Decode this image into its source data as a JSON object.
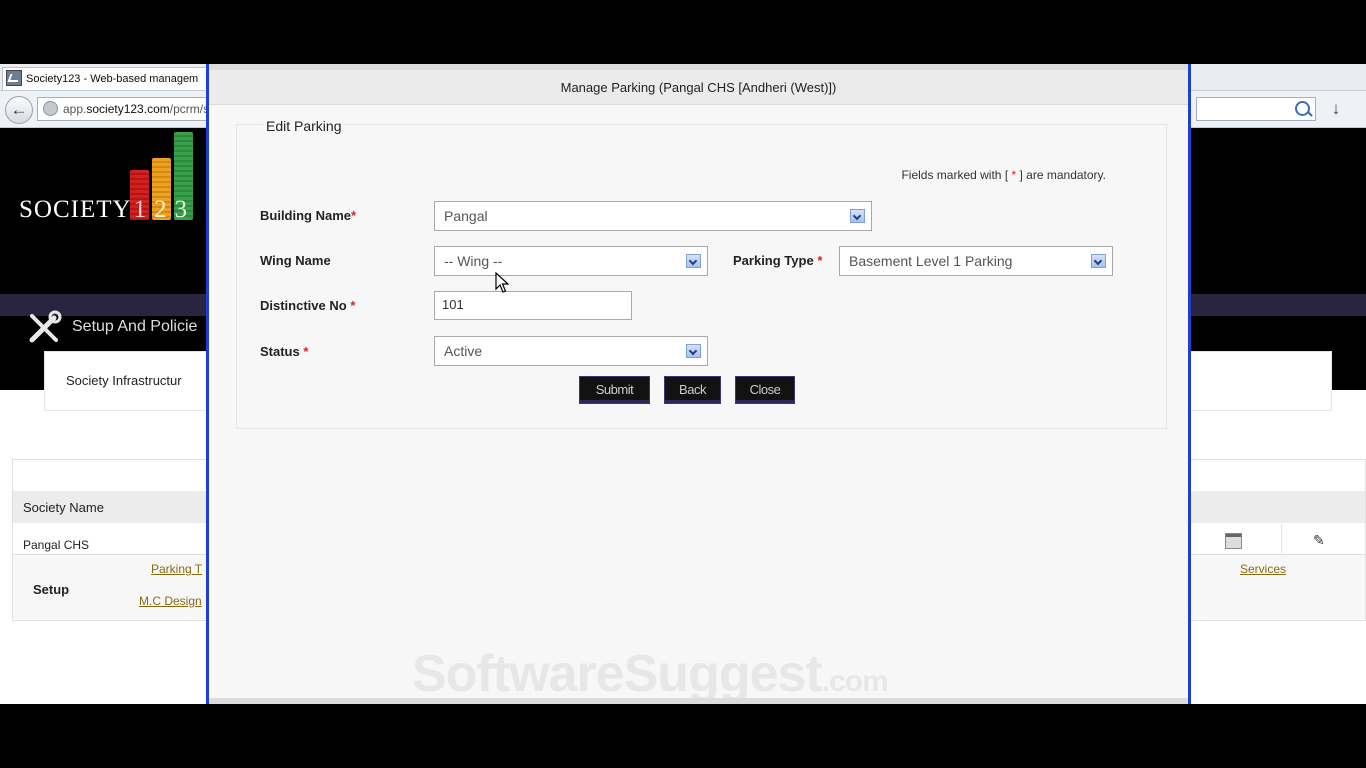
{
  "browser": {
    "tab_title": "Society123 - Web-based managem",
    "url_host": "app.society123.com",
    "url_path": "/pcrm/s"
  },
  "app": {
    "logo_text": "SOCIETY",
    "logo_digits": [
      "1",
      "2",
      "3"
    ],
    "menu_label": "Setup And Policie"
  },
  "page": {
    "infrastructure_label": "Society Infrastructur",
    "table": {
      "header_society_name": "Society Name",
      "row_society_name": "Pangal CHS",
      "setup_label": "Setup",
      "links": [
        "Parking T",
        "M.C Design",
        "Services"
      ]
    }
  },
  "modal": {
    "title": "Manage Parking (Pangal CHS [Andheri (West)])",
    "legend": "Edit Parking",
    "mandatory_note_prefix": "Fields marked with [ ",
    "mandatory_note_star": "*",
    "mandatory_note_suffix": " ] are mandatory.",
    "required_mark": "*",
    "fields": {
      "building_name_label": "Building Name",
      "building_name_value": "Pangal",
      "wing_name_label": "Wing Name",
      "wing_name_value": "-- Wing --",
      "parking_type_label": "Parking Type",
      "parking_type_value": "Basement Level 1 Parking",
      "distinctive_no_label": "Distinctive No",
      "distinctive_no_value": "101",
      "status_label": "Status",
      "status_value": "Active"
    },
    "buttons": {
      "submit": "Submit",
      "back": "Back",
      "close": "Close"
    }
  },
  "watermark": {
    "main": "SoftwareSuggest",
    "suffix": ".com"
  },
  "colors": {
    "modal_border": "#1d3fd4",
    "button_bg": "#121212",
    "required": "#d22222",
    "link": "#8a6a10"
  }
}
